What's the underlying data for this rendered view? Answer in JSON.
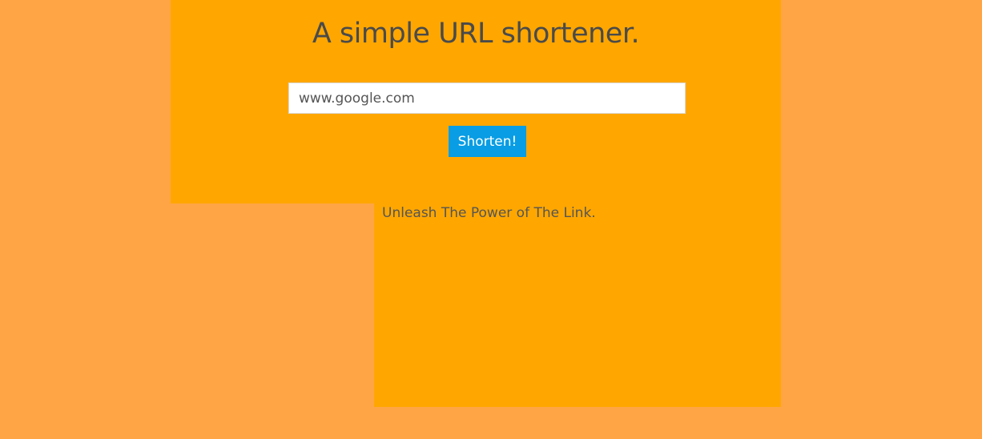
{
  "header": {
    "title": "A simple URL shortener."
  },
  "form": {
    "url_value": "www.google.com",
    "submit_label": "Shorten!"
  },
  "content": {
    "tagline": "Unleash The Power of The Link."
  },
  "colors": {
    "page_background": "#FFA545",
    "panel_background": "#FFA700",
    "button_background": "#089DE4",
    "text": "#4A4A4A"
  }
}
